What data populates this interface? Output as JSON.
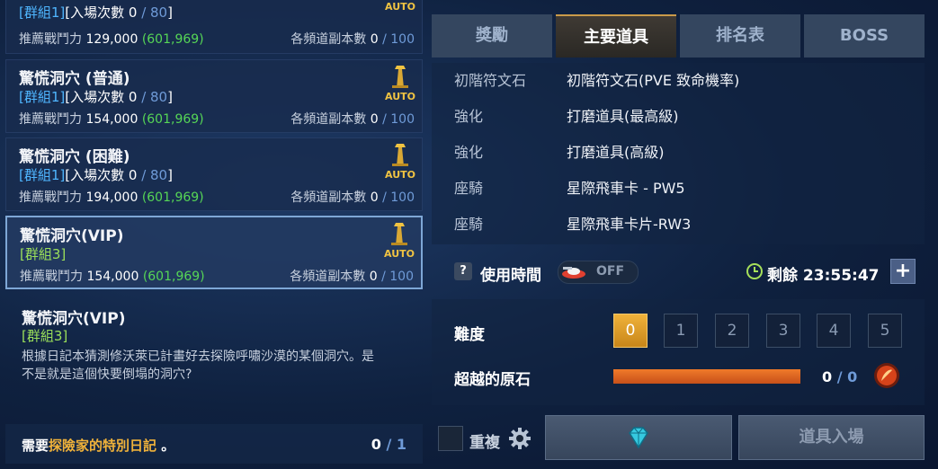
{
  "cards": [
    {
      "title": "",
      "group": "[群組1]",
      "entries_label": "[入場次數 ",
      "entries": "0",
      "entries_max": "80",
      "power_label": "推薦戰鬥力 ",
      "power": "129,000",
      "power_paren": "(601,969)",
      "channel_label": "各頻道副本數 ",
      "channel": "0",
      "channel_max": "100",
      "auto": "AUTO"
    },
    {
      "title": "驚慌洞穴 (普通)",
      "group": "[群組1]",
      "entries_label": "[入場次數 ",
      "entries": "0",
      "entries_max": "80",
      "power_label": "推薦戰鬥力 ",
      "power": "154,000",
      "power_paren": "(601,969)",
      "channel_label": "各頻道副本數 ",
      "channel": "0",
      "channel_max": "100",
      "auto": "AUTO"
    },
    {
      "title": "驚慌洞穴 (困難)",
      "group": "[群組1]",
      "entries_label": "[入場次數 ",
      "entries": "0",
      "entries_max": "80",
      "power_label": "推薦戰鬥力 ",
      "power": "194,000",
      "power_paren": "(601,969)",
      "channel_label": "各頻道副本數 ",
      "channel": "0",
      "channel_max": "100",
      "auto": "AUTO"
    },
    {
      "title": "驚慌洞穴(VIP)",
      "group": "[群組3]",
      "power_label": "推薦戰鬥力 ",
      "power": "154,000",
      "power_paren": "(601,969)",
      "channel_label": "各頻道副本數 ",
      "channel": "0",
      "channel_max": "100",
      "auto": "AUTO"
    }
  ],
  "detail": {
    "title": "驚慌洞穴(VIP)",
    "group": "[群組3]",
    "text_line1": "根據日記本猜測修沃萊已計畫好去探險呼嘯沙漠的某個洞穴。是",
    "text_line2": "不是就是這個快要倒塌的洞穴?"
  },
  "requirement": {
    "prefix": "需要",
    "item": "探險家的特別日記",
    "suffix": " 。",
    "have": "0",
    "need": "1"
  },
  "tabs": [
    "獎勵",
    "主要道具",
    "排名表",
    "BOSS"
  ],
  "active_tab": 1,
  "items": [
    {
      "k": "初階符文石",
      "v": "初階符文石(PVE 致命機率)"
    },
    {
      "k": "強化",
      "v": "打磨道具(最高級)"
    },
    {
      "k": "強化",
      "v": "打磨道具(高級)"
    },
    {
      "k": "座騎",
      "v": "星際飛車卡 - PW5"
    },
    {
      "k": "座騎",
      "v": "星際飛車卡片-RW3"
    }
  ],
  "usage": {
    "help": "?",
    "label": "使用時間",
    "toggle": "OFF",
    "remain_label": "剩餘 ",
    "remain_time": "23:55:47",
    "plus": "+"
  },
  "difficulty": {
    "label": "難度",
    "levels": [
      "0",
      "1",
      "2",
      "3",
      "4",
      "5"
    ],
    "selected": 0
  },
  "stone": {
    "label": "超越的原石",
    "have": "0",
    "need": "0",
    "fill": 1.0
  },
  "repeat": {
    "label": "重複"
  },
  "enter_button": "道具入場",
  "colors": {
    "accent_gold": "#f0b23a",
    "group_blue": "#4fb6ff",
    "group_green": "#9be05a",
    "power_green": "#56d656",
    "bar_orange": "#e0661e"
  }
}
